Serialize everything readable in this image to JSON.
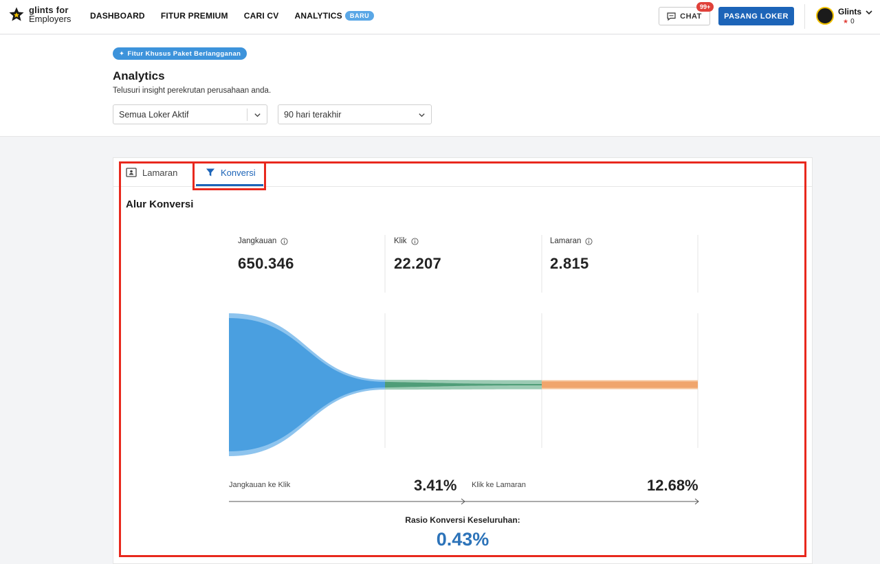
{
  "brand": {
    "line1": "glints for",
    "line2": "Employers"
  },
  "nav": {
    "items": [
      "DASHBOARD",
      "FITUR PREMIUM",
      "CARI CV",
      "ANALYTICS"
    ],
    "analytics_badge": "BARU"
  },
  "topbar": {
    "chat_label": "CHAT",
    "chat_count": "99+",
    "post_job_label": "PASANG LOKER",
    "user_name": "Glints",
    "user_points": "0"
  },
  "header": {
    "feature_pill": "Fitur Khusus Paket Berlangganan",
    "title": "Analytics",
    "subtitle": "Telusuri insight perekrutan perusahaan anda.",
    "job_filter": "Semua Loker Aktif",
    "period_filter": "90 hari terakhir"
  },
  "tabs": [
    {
      "label": "Lamaran"
    },
    {
      "label": "Konversi"
    }
  ],
  "funnel": {
    "title": "Alur Konversi",
    "stages": [
      {
        "label": "Jangkauan",
        "value": "650.346"
      },
      {
        "label": "Klik",
        "value": "22.207"
      },
      {
        "label": "Lamaran",
        "value": "2.815"
      }
    ],
    "conversions": [
      {
        "label": "Jangkauan ke Klik",
        "value": "3.41%"
      },
      {
        "label": "Klik ke Lamaran",
        "value": "12.68%"
      }
    ],
    "overall_label": "Rasio Konversi Keseluruhan:",
    "overall_value": "0.43%",
    "colors": {
      "stage1": "#4a9fe0",
      "stage1_edge": "#8ec4ee",
      "stage2": "#4f9d78",
      "stage2_edge": "#9ccbb4",
      "stage3": "#f0a56c",
      "stage3_edge": "#f6c79f"
    }
  },
  "chart_data": {
    "type": "funnel",
    "categories": [
      "Jangkauan",
      "Klik",
      "Lamaran"
    ],
    "values": [
      650346,
      22207,
      2815
    ],
    "conversion_rates": {
      "Jangkauan ke Klik": 3.41,
      "Klik ke Lamaran": 12.68,
      "Rasio Konversi Keseluruhan": 0.43
    },
    "title": "Alur Konversi"
  },
  "highlight_color": "#e8281d"
}
